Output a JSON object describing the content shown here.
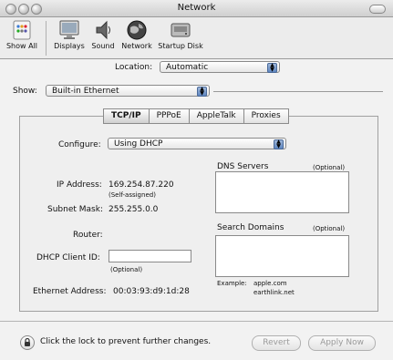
{
  "window": {
    "title": "Network"
  },
  "toolbar": {
    "items": [
      {
        "label": "Show All",
        "icon": "show-all-icon"
      },
      {
        "label": "Displays",
        "icon": "displays-icon"
      },
      {
        "label": "Sound",
        "icon": "sound-icon"
      },
      {
        "label": "Network",
        "icon": "network-globe-icon"
      },
      {
        "label": "Startup Disk",
        "icon": "startup-disk-icon"
      }
    ]
  },
  "location": {
    "label": "Location:",
    "value": "Automatic"
  },
  "show": {
    "label": "Show:",
    "value": "Built-in Ethernet"
  },
  "tabs": [
    {
      "label": "TCP/IP",
      "selected": true
    },
    {
      "label": "PPPoE",
      "selected": false
    },
    {
      "label": "AppleTalk",
      "selected": false
    },
    {
      "label": "Proxies",
      "selected": false
    }
  ],
  "configure": {
    "label": "Configure:",
    "value": "Using DHCP"
  },
  "dns": {
    "label": "DNS Servers",
    "optional": "(Optional)"
  },
  "search_domains": {
    "label": "Search Domains",
    "optional": "(Optional)"
  },
  "ip": {
    "label": "IP Address:",
    "value": "169.254.87.220",
    "note": "(Self-assigned)"
  },
  "subnet": {
    "label": "Subnet Mask:",
    "value": "255.255.0.0"
  },
  "router": {
    "label": "Router:"
  },
  "dhcp": {
    "label": "DHCP Client ID:",
    "value": "",
    "note": "(Optional)"
  },
  "ethernet": {
    "label": "Ethernet Address:",
    "value": "00:03:93:d9:1d:28"
  },
  "example": {
    "label": "Example:",
    "line1": "apple.com",
    "line2": "earthlink.net"
  },
  "footer": {
    "lock_text": "Click the lock to prevent further changes.",
    "revert": "Revert",
    "apply": "Apply Now"
  }
}
